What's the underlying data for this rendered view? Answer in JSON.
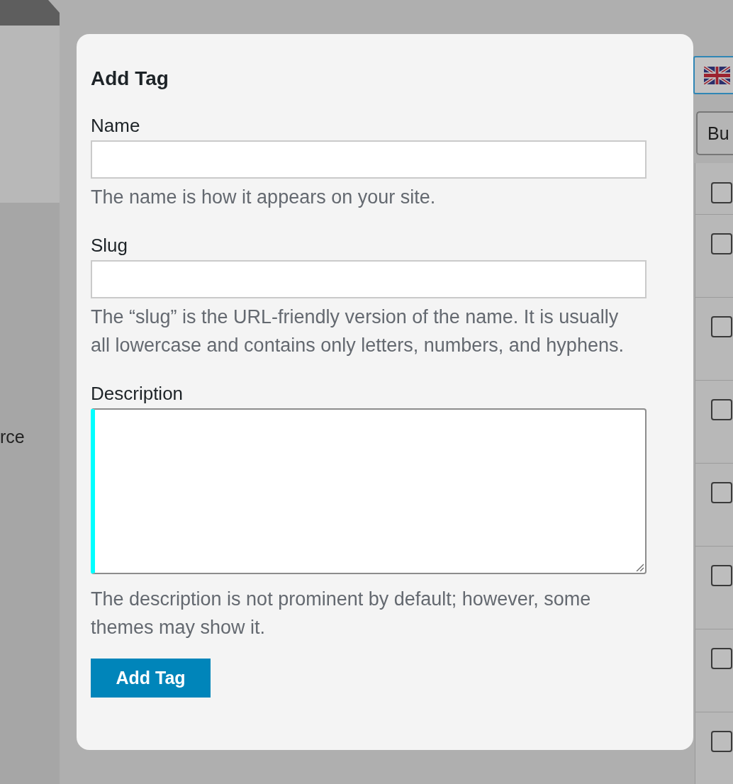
{
  "background": {
    "sidebar_text": "rce"
  },
  "dialog": {
    "title": "Add Tag",
    "fields": [
      {
        "kind": "text",
        "label": "Name",
        "hint": "The name is how it appears on your site.",
        "highlighted": false
      },
      {
        "kind": "text",
        "label": "Slug",
        "hint": "The “slug” is the URL-friendly version of the name. It is usually all lowercase and contains only letters, numbers, and hyphens.",
        "highlighted": false
      },
      {
        "kind": "textarea",
        "label": "Description",
        "hint": "The description is not prominent by default; however, some themes may show it.",
        "highlighted": true
      }
    ],
    "submit_button": "Add Tag"
  },
  "toolbar": {
    "button": "Bu"
  },
  "table": {
    "header": {
      "checked": false
    },
    "rows": [
      {
        "checked": false
      },
      {
        "checked": false
      },
      {
        "checked": false
      },
      {
        "checked": false
      },
      {
        "checked": false
      },
      {
        "checked": false
      },
      {
        "checked": false
      }
    ]
  }
}
